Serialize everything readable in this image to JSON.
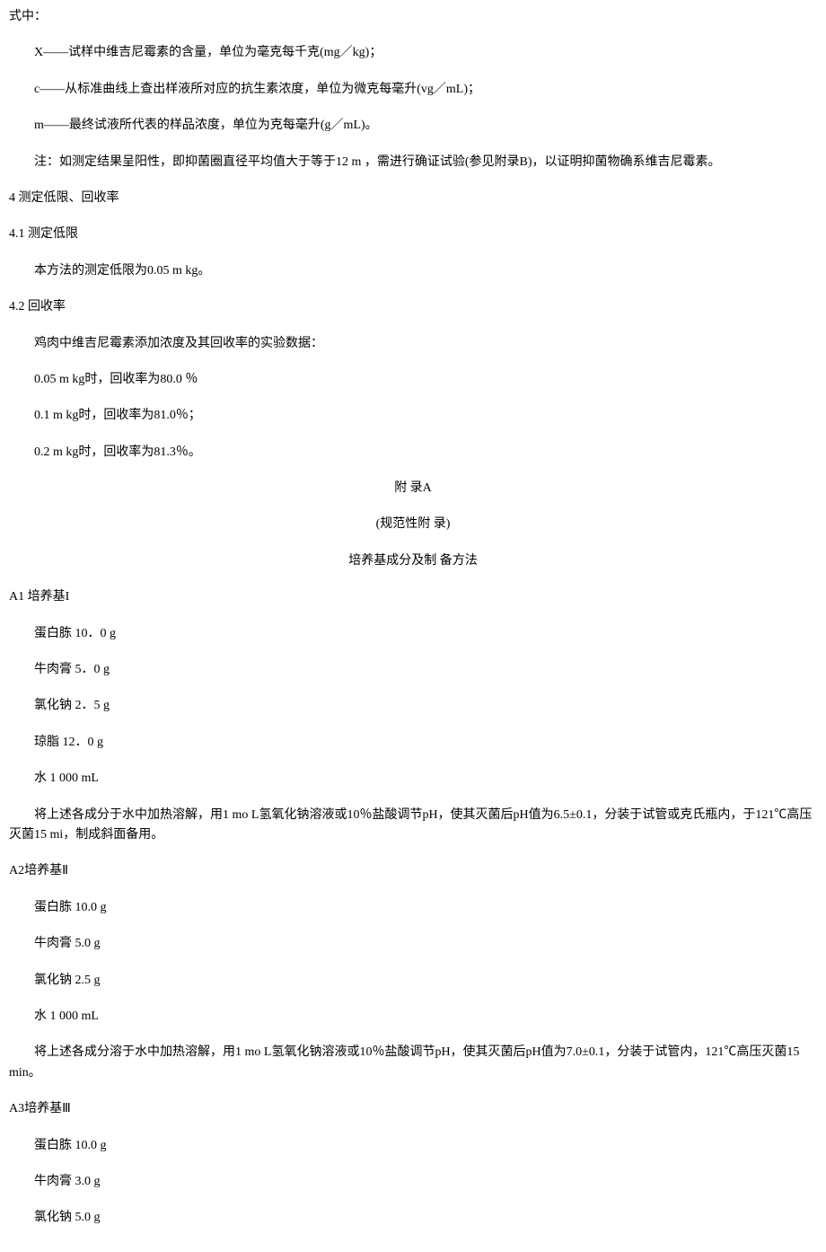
{
  "top": {
    "line0": "式中：",
    "line1": "X——试样中维吉尼霉素的含量，单位为毫克每千克(mg／kg)；",
    "line2": "c——从标准曲线上查出样液所对应的抗生素浓度，单位为微克每毫升(vg／mL)；",
    "line3": "m——最终试液所代表的样品浓度，单位为克每毫升(g／mL)。",
    "line4": "注：如测定结果呈阳性，即抑菌圈直径平均值大于等于12 m ，需进行确证试验(参见附录B)，以证明抑菌物确系维吉尼霉素。"
  },
  "sec4": {
    "title": "4 测定低限、回收率",
    "sec41_title": "4.1 测定低限",
    "sec41_body": "本方法的测定低限为0.05  m  kg。",
    "sec42_title": "4.2 回收率",
    "sec42_body1": "鸡肉中维吉尼霉素添加浓度及其回收率的实验数据：",
    "sec42_body2": "0.05  m  kg时，回收率为80.0  ％",
    "sec42_body3": "0.1  m  kg时，回收率为81.0％；",
    "sec42_body4": "0.2  m  kg时，回收率为81.3％。"
  },
  "appendixA": {
    "title1": "附  录A",
    "title2": "(规范性附 录)",
    "title3": "培养基成分及制 备方法"
  },
  "a1": {
    "title": "A1 培养基I",
    "ing1": "蛋白胨   10．0  g",
    "ing2": "牛肉膏   5．0  g",
    "ing3": "氯化钠   2．5  g",
    "ing4": "琼脂   12．0  g",
    "ing5": "水   1  000  mL",
    "desc": "将上述各成分于水中加热溶解，用1  mo  L氢氧化钠溶液或10％盐酸调节pH，使其灭菌后pH值为6.5±0.1，分装于试管或克氏瓶内，于121℃高压灭菌15  mi，制成斜面备用。"
  },
  "a2": {
    "title": "A2培养基Ⅱ",
    "ing1": "蛋白胨   10.0  g",
    "ing2": "牛肉膏   5.0  g",
    "ing3": "氯化钠   2.5  g",
    "ing4": "水   1  000  mL",
    "desc": "将上述各成分溶于水中加热溶解，用1  mo  L氢氧化钠溶液或10％盐酸调节pH，使其灭菌后pH值为7.0±0.1，分装于试管内，121℃高压灭菌15 min。"
  },
  "a3": {
    "title": "A3培养基Ⅲ",
    "ing1": "蛋白胨   10.0  g",
    "ing2": "牛肉膏   3.0  g",
    "ing3": "氯化钠   5.0  g"
  }
}
